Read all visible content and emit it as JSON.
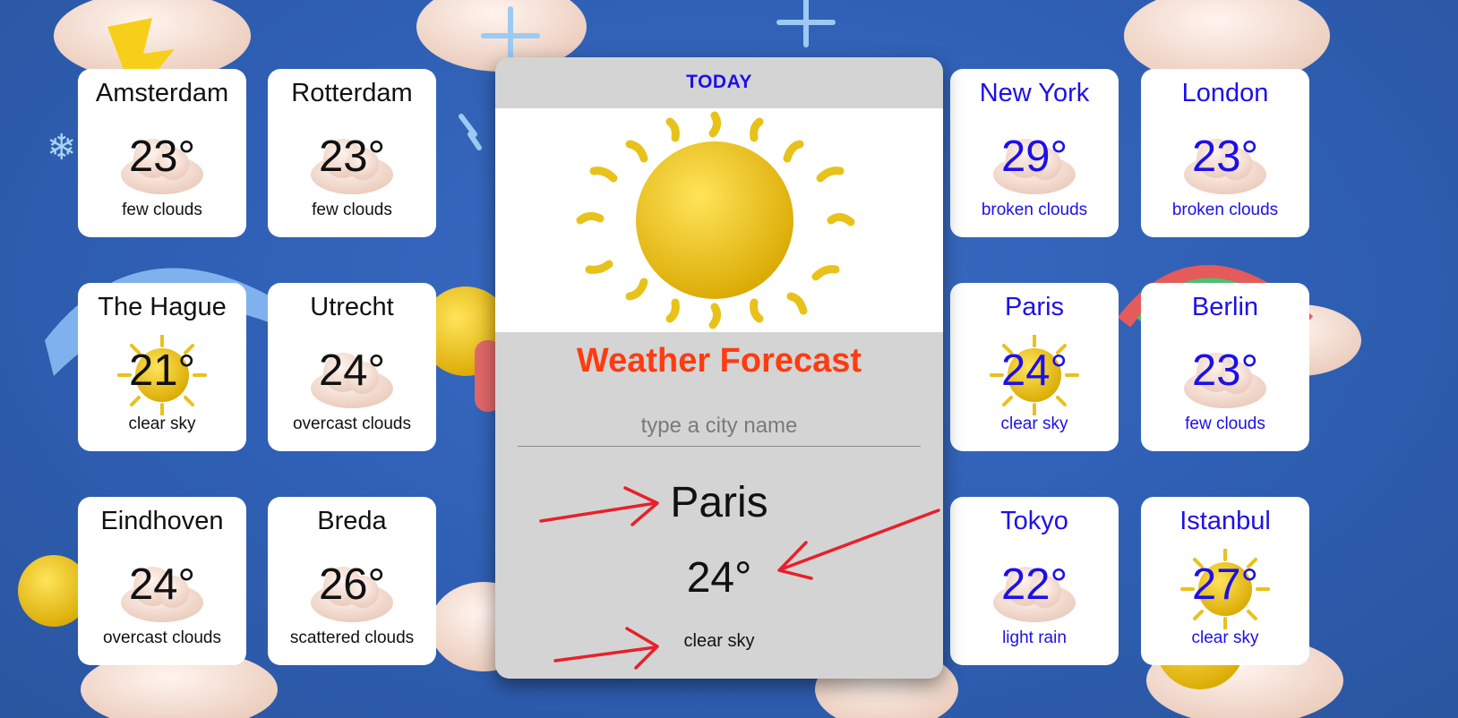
{
  "panel": {
    "tab": "TODAY",
    "title": "Weather Forecast",
    "search_placeholder": "type a city name",
    "city": "Paris",
    "temp": "24°",
    "desc": "clear sky",
    "hero_icon": "sun-icon"
  },
  "cities_nl": [
    {
      "city": "Amsterdam",
      "temp": "23°",
      "desc": "few clouds",
      "icon": "cloud-icon"
    },
    {
      "city": "Rotterdam",
      "temp": "23°",
      "desc": "few clouds",
      "icon": "cloud-icon"
    },
    {
      "city": "The Hague",
      "temp": "21°",
      "desc": "clear sky",
      "icon": "sun-icon"
    },
    {
      "city": "Utrecht",
      "temp": "24°",
      "desc": "overcast clouds",
      "icon": "cloud-icon"
    },
    {
      "city": "Eindhoven",
      "temp": "24°",
      "desc": "overcast clouds",
      "icon": "cloud-icon"
    },
    {
      "city": "Breda",
      "temp": "26°",
      "desc": "scattered clouds",
      "icon": "cloud-icon"
    }
  ],
  "cities_world": [
    {
      "city": "New York",
      "temp": "29°",
      "desc": "broken clouds",
      "icon": "cloud-icon"
    },
    {
      "city": "London",
      "temp": "23°",
      "desc": "broken clouds",
      "icon": "cloud-icon"
    },
    {
      "city": "Paris",
      "temp": "24°",
      "desc": "clear sky",
      "icon": "sun-icon"
    },
    {
      "city": "Berlin",
      "temp": "23°",
      "desc": "few clouds",
      "icon": "cloud-icon"
    },
    {
      "city": "Tokyo",
      "temp": "22°",
      "desc": "light rain",
      "icon": "cloud-icon"
    },
    {
      "city": "Istanbul",
      "temp": "27°",
      "desc": "clear sky",
      "icon": "sun-icon"
    }
  ],
  "colors": {
    "accent": "#1d10e8",
    "title": "#ff3b10",
    "panel_bg": "#d4d4d4",
    "page_bg": "#2f5fb4",
    "annotation": "#e8202a"
  }
}
